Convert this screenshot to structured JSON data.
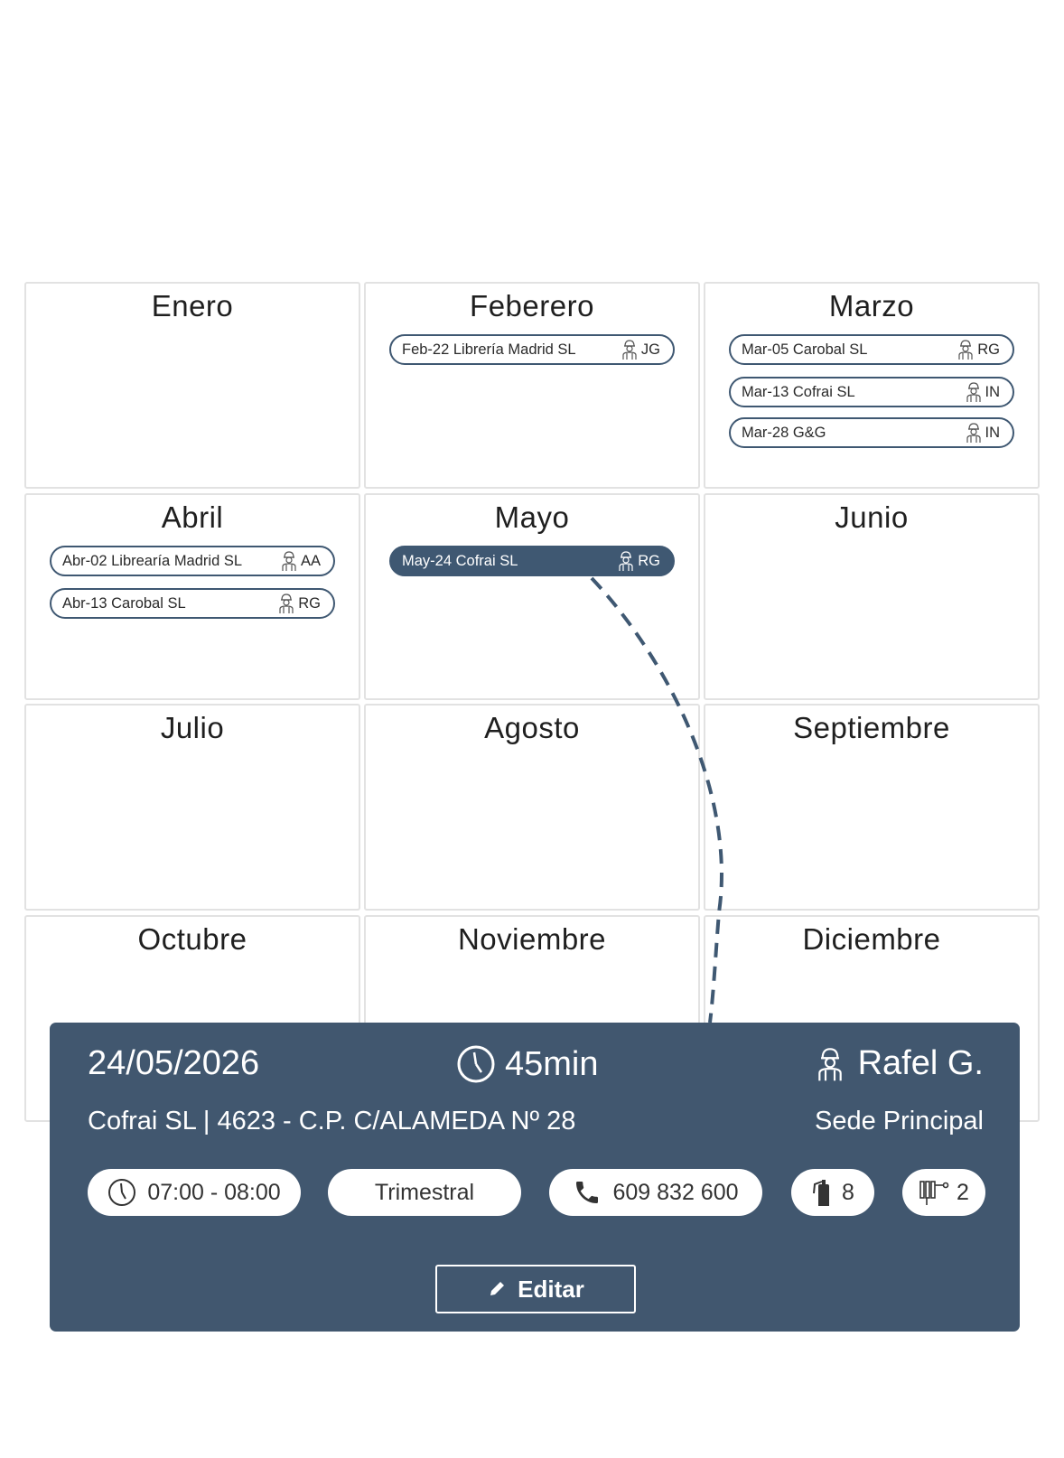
{
  "months": [
    {
      "name": "Enero",
      "events": []
    },
    {
      "name": "Feberero",
      "events": [
        {
          "label": "Feb-22 Librería Madrid SL",
          "tech": "JG"
        }
      ]
    },
    {
      "name": "Marzo",
      "events": [
        {
          "label": "Mar-05 Carobal SL",
          "tech": "RG"
        },
        {
          "label": "Mar-13 Cofrai SL",
          "tech": "IN"
        },
        {
          "label": "Mar-28 G&G",
          "tech": "IN"
        }
      ]
    },
    {
      "name": "Abril",
      "events": [
        {
          "label": "Abr-02 Librearía Madrid SL",
          "tech": "AA"
        },
        {
          "label": "Abr-13 Carobal SL",
          "tech": "RG"
        }
      ]
    },
    {
      "name": "Mayo",
      "events": [
        {
          "label": "May-24 Cofrai SL",
          "tech": "RG",
          "selected": true
        }
      ]
    },
    {
      "name": "Junio",
      "events": []
    },
    {
      "name": "Julio",
      "events": []
    },
    {
      "name": "Agosto",
      "events": []
    },
    {
      "name": "Septiembre",
      "events": []
    },
    {
      "name": "Octubre",
      "events": []
    },
    {
      "name": "Noviembre",
      "events": []
    },
    {
      "name": "Diciembre",
      "events": []
    }
  ],
  "detail": {
    "date": "24/05/2026",
    "duration": "45min",
    "technician": "Rafel G.",
    "address": "Cofrai SL | 4623 - C.P. C/ALAMEDA Nº 28",
    "site": "Sede Principal",
    "time_range": "07:00 - 08:00",
    "frequency": "Trimestral",
    "phone": "609 832 600",
    "extinguishers": "8",
    "hoses": "2",
    "edit_label": "Editar"
  },
  "colors": {
    "accent": "#41576f",
    "border": "#e2e2e2",
    "white": "#ffffff"
  }
}
